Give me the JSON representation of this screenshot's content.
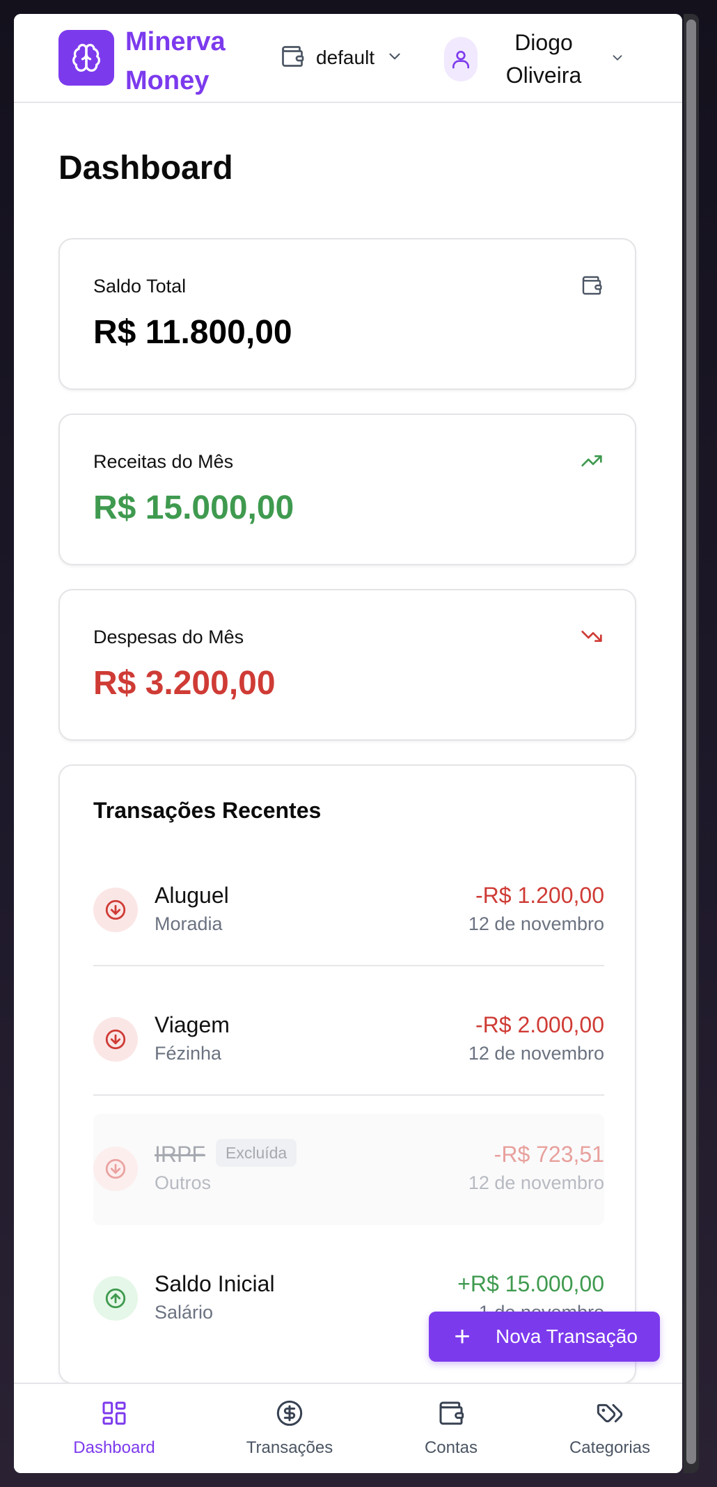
{
  "header": {
    "brand_line1": "Minerva",
    "brand_line2": "Money",
    "wallet_label": "default",
    "user_first": "Diogo",
    "user_last": "Oliveira"
  },
  "main": {
    "title": "Dashboard",
    "stats": [
      {
        "label": "Saldo Total",
        "value": "R$ 11.800,00",
        "color": "#000000",
        "icon": "wallet-icon"
      },
      {
        "label": "Receitas do Mês",
        "value": "R$ 15.000,00",
        "color": "#3f9a4f",
        "icon": "trending-up-icon"
      },
      {
        "label": "Despesas do Mês",
        "value": "R$ 3.200,00",
        "color": "#cf3b35",
        "icon": "trending-down-icon"
      }
    ],
    "recent": {
      "title": "Transações Recentes",
      "items": [
        {
          "name": "Aluguel",
          "category": "Moradia",
          "amount": "-R$ 1.200,00",
          "date": "12 de novembro",
          "type": "expense"
        },
        {
          "name": "Viagem",
          "category": "Fézinha",
          "amount": "-R$ 2.000,00",
          "date": "12 de novembro",
          "type": "expense"
        },
        {
          "name": "IRPF",
          "category": "Outros",
          "amount": "-R$ 723,51",
          "date": "12 de novembro",
          "type": "expense",
          "badge": "Excluída"
        },
        {
          "name": "Saldo Inicial",
          "category": "Salário",
          "amount": "+R$ 15.000,00",
          "date": "1 de novembro",
          "type": "income"
        }
      ]
    },
    "fab_label": "Nova Transação"
  },
  "nav": [
    {
      "label": "Dashboard",
      "icon": "grid-icon",
      "active": true
    },
    {
      "label": "Transações",
      "icon": "dollar-circle-icon"
    },
    {
      "label": "Contas",
      "icon": "wallet-icon"
    },
    {
      "label": "Categorias",
      "icon": "tags-icon"
    }
  ],
  "colors": {
    "accent": "#7c3aed",
    "income": "#3f9a4f",
    "expense": "#cf3b35",
    "muted": "#6b7280"
  }
}
